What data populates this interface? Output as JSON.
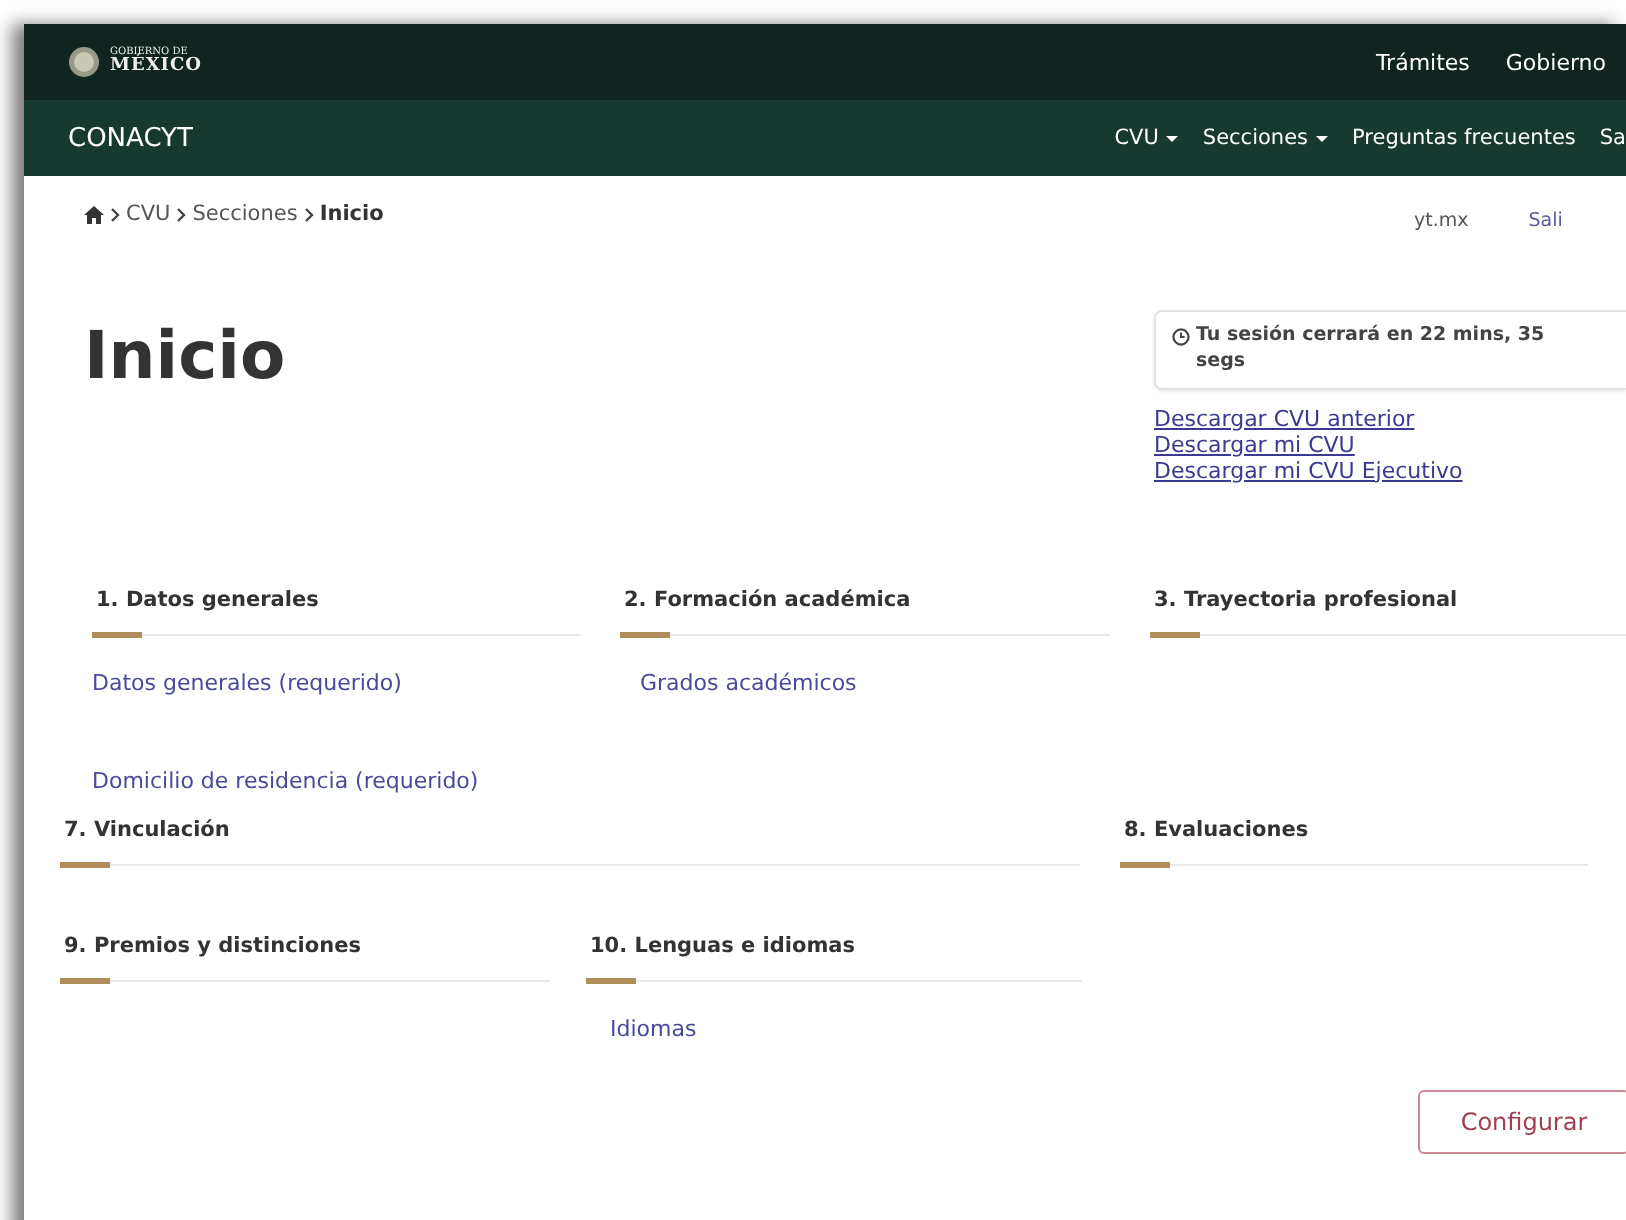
{
  "header": {
    "logo_small": "GOBIERNO DE",
    "logo": "MÉXICO",
    "links": [
      "Trámites",
      "Gobierno"
    ]
  },
  "navbar": {
    "brand": "CONACYT",
    "items": [
      {
        "label": "CVU",
        "dropdown": true
      },
      {
        "label": "Secciones",
        "dropdown": true
      },
      {
        "label": "Preguntas frecuentes",
        "dropdown": false
      },
      {
        "label": "Sa",
        "dropdown": false
      }
    ]
  },
  "breadcrumb": [
    {
      "label": "CVU",
      "current": false
    },
    {
      "label": "Secciones",
      "current": false
    },
    {
      "label": "Inicio",
      "current": true
    }
  ],
  "user_links": [
    "yt.mx",
    "Sali"
  ],
  "page_title": "Inicio",
  "session_notice": "Tu sesión cerrará en 22 mins, 35 segs",
  "downloads": [
    "Descargar CVU anterior",
    "Descargar mi CVU",
    "Descargar mi CVU Ejecutivo"
  ],
  "section_rows": [
    [
      {
        "title": "1. Datos generales",
        "links": [
          "Datos generales (requerido)",
          "Domicilio de residencia (requerido)"
        ]
      },
      {
        "title": "2. Formación académica",
        "links": [
          "Grados académicos"
        ]
      },
      {
        "title": "3. Trayectoria profesional"
      }
    ],
    [
      {
        "title": "7. Vinculación"
      },
      {
        "title": "8. Evaluaciones"
      }
    ],
    [
      {
        "title": "9. Premios y distinciones"
      },
      {
        "title": "10. Lenguas e idiomas",
        "links": [
          "Idiomas"
        ]
      }
    ]
  ],
  "configure_button": "Configurar"
}
